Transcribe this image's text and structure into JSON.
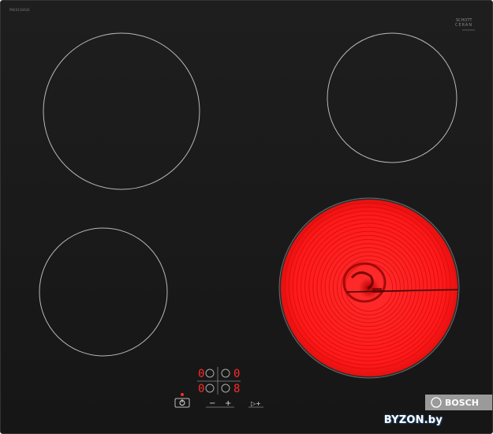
{
  "product": {
    "model_code": "PKE611BA2E",
    "schott_label_line1": "SCHOTT",
    "schott_label_line2": "CERAN",
    "brand": "BOSCH"
  },
  "controls": {
    "display_left_top": "0",
    "display_left_top_b": "0",
    "display_right_top": "0",
    "display_right_top_b": "0",
    "display_left_bottom": "0",
    "display_left_bottom_b": "0",
    "display_right_bottom": "0",
    "display_right_bottom_b": "8",
    "minus_label": "−",
    "plus_label": "+",
    "timer_label": "▷+"
  },
  "zones": {
    "active_zone": "front-right",
    "active_color": "#ff1a1a"
  },
  "watermark": "BYZON.by"
}
